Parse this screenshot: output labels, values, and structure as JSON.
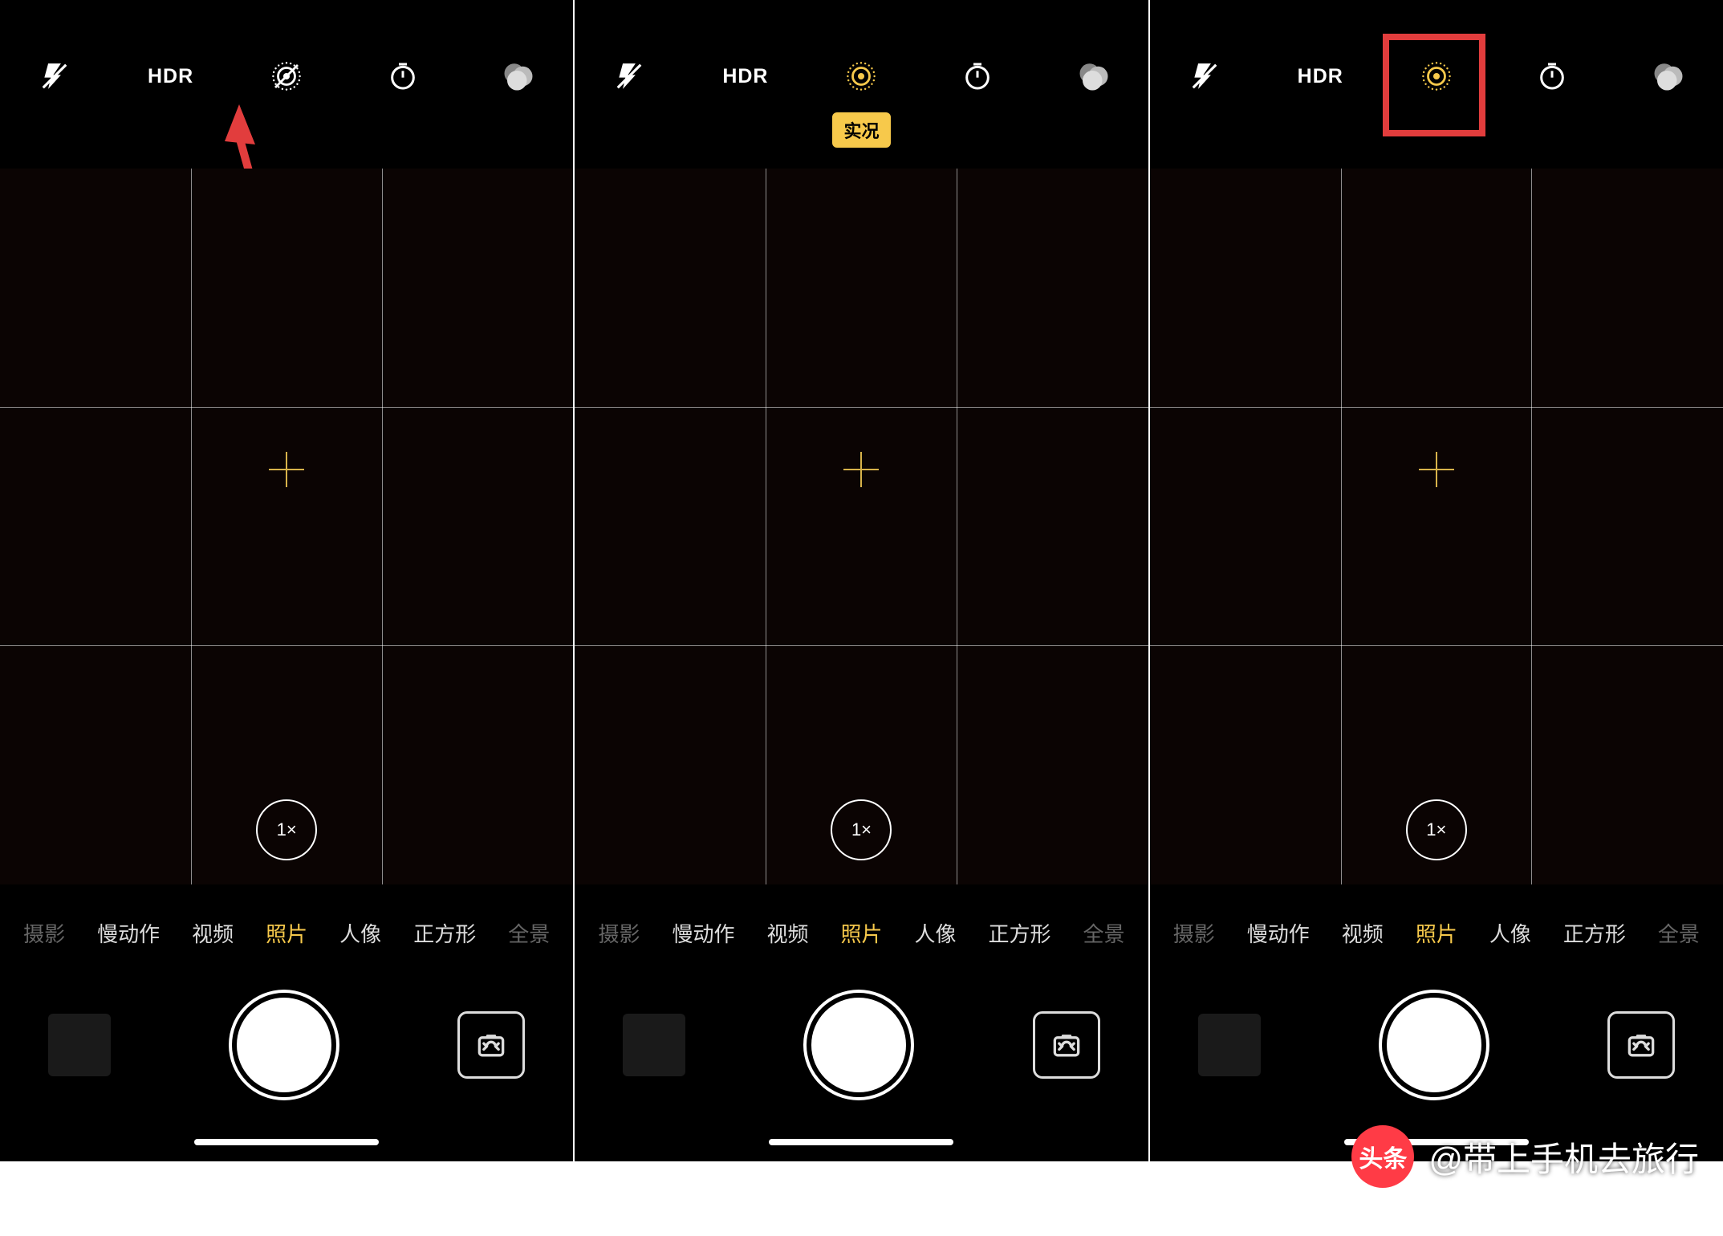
{
  "colors": {
    "accent": "#f7c94b",
    "highlight": "#e23d3d"
  },
  "hdr_label": "HDR",
  "zoom_label": "1×",
  "live_badge": "实况",
  "modes": {
    "edge_left": "摄影",
    "slow_mo": "慢动作",
    "video": "视频",
    "photo": "照片",
    "portrait": "人像",
    "square": "正方形",
    "edge_right": "全景"
  },
  "watermark": {
    "brand": "头条",
    "handle": "@带上手机去旅行"
  },
  "screens": [
    {
      "live_photo_on": false,
      "show_live_badge": false,
      "show_arrow": true,
      "show_red_box": false
    },
    {
      "live_photo_on": true,
      "show_live_badge": true,
      "show_arrow": false,
      "show_red_box": false
    },
    {
      "live_photo_on": true,
      "show_live_badge": false,
      "show_arrow": false,
      "show_red_box": true
    }
  ]
}
